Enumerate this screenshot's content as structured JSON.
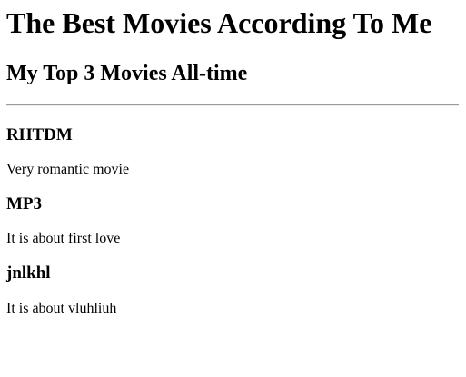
{
  "page": {
    "title": "The Best Movies According To Me",
    "subtitle": "My Top 3 Movies All-time"
  },
  "movies": [
    {
      "name": "RHTDM",
      "description": "Very romantic movie"
    },
    {
      "name": "MP3",
      "description": "It is about first love"
    },
    {
      "name": "jnlkhl",
      "description": "It is about vluhliuh"
    }
  ]
}
